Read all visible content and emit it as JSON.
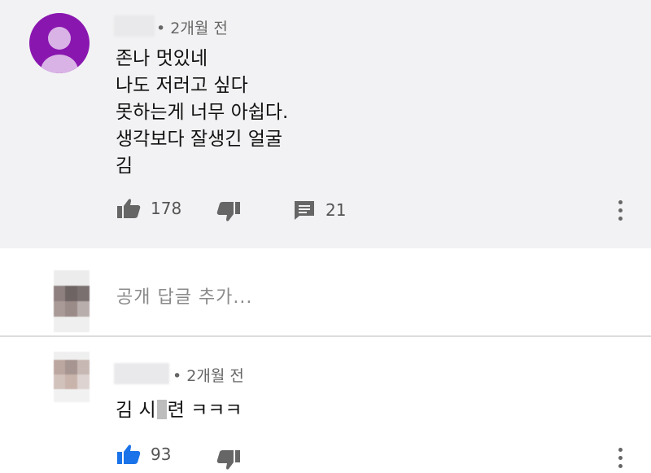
{
  "comment": {
    "time": "• 2개월 전",
    "lines": [
      "존나 멋있네",
      "나도 저러고 싶다",
      "못하는게 너무 아쉽다.",
      "생각보다 잘생긴 얼굴",
      "김"
    ],
    "like_count": "178",
    "reply_count": "21"
  },
  "reply_input": {
    "placeholder": "공개 답글 추가..."
  },
  "reply": {
    "time": "• 2개월 전",
    "text_before": "김 시",
    "text_after": "련 ㅋㅋㅋ",
    "like_count": "93"
  },
  "colors": {
    "avatar": "#8a16b0",
    "comment_bg": "#f2f2f4",
    "like_active": "#1a73e8"
  },
  "icons": [
    "thumbs-up-icon",
    "thumbs-down-icon",
    "comment-icon",
    "more-vert-icon"
  ]
}
